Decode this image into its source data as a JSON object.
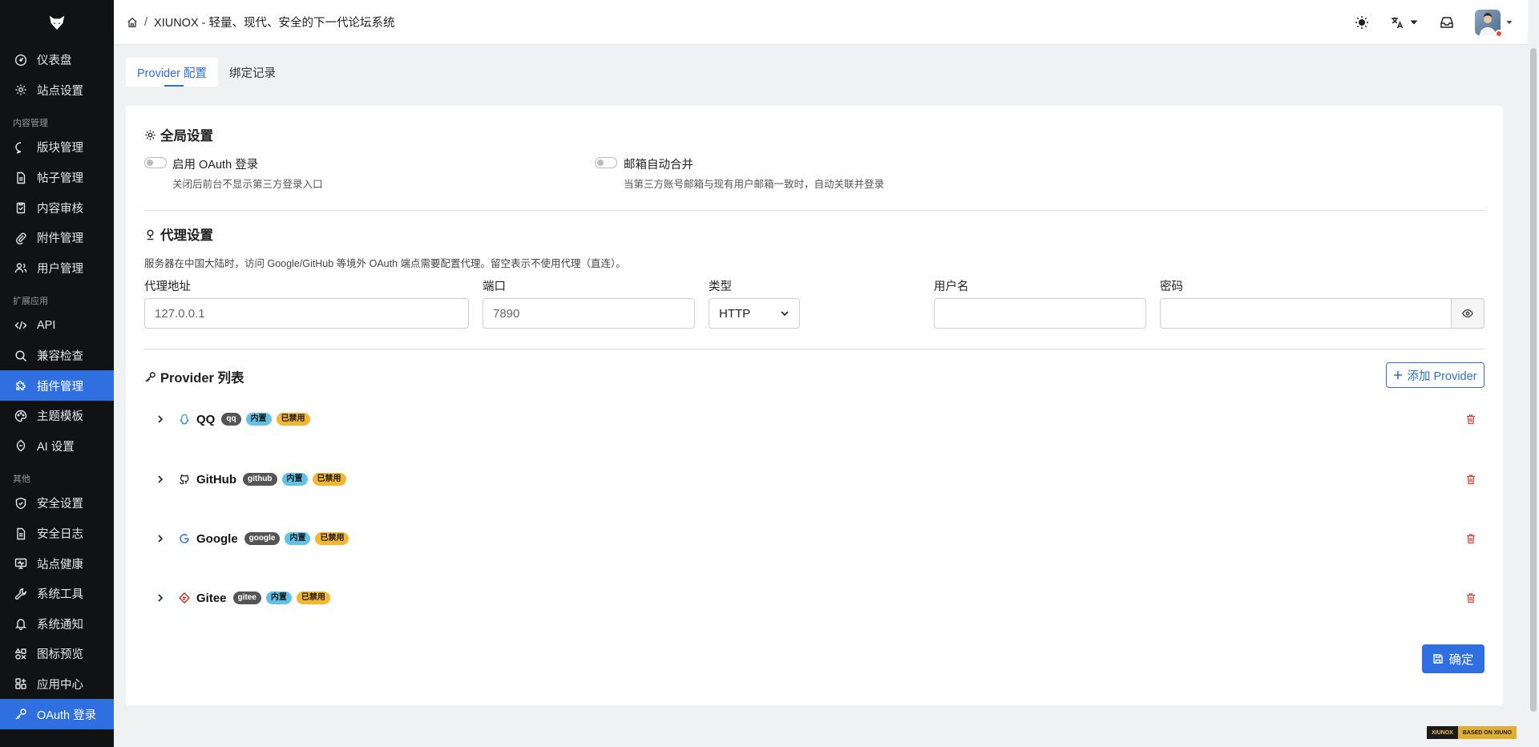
{
  "sidebar": {
    "top_items": [
      {
        "label": "仪表盘",
        "icon": "dashboard-icon"
      },
      {
        "label": "站点设置",
        "icon": "gear-icon"
      }
    ],
    "groups": [
      {
        "title": "内容管理",
        "items": [
          {
            "label": "版块管理",
            "icon": "chat-bubble-icon"
          },
          {
            "label": "帖子管理",
            "icon": "document-icon"
          },
          {
            "label": "内容审核",
            "icon": "clipboard-check-icon"
          },
          {
            "label": "附件管理",
            "icon": "paperclip-icon"
          },
          {
            "label": "用户管理",
            "icon": "users-icon"
          }
        ]
      },
      {
        "title": "扩展应用",
        "items": [
          {
            "label": "API",
            "icon": "code-icon"
          },
          {
            "label": "兼容检查",
            "icon": "search-icon"
          },
          {
            "label": "插件管理",
            "icon": "puzzle-icon",
            "active": true
          },
          {
            "label": "主题模板",
            "icon": "palette-icon"
          },
          {
            "label": "AI 设置",
            "icon": "robot-icon"
          }
        ]
      },
      {
        "title": "其他",
        "items": [
          {
            "label": "安全设置",
            "icon": "shield-icon"
          },
          {
            "label": "安全日志",
            "icon": "log-document-icon"
          },
          {
            "label": "站点健康",
            "icon": "monitor-icon"
          },
          {
            "label": "系统工具",
            "icon": "wrench-icon"
          },
          {
            "label": "系统通知",
            "icon": "bell-icon"
          },
          {
            "label": "图标预览",
            "icon": "icons-grid-icon"
          },
          {
            "label": "应用中心",
            "icon": "apps-icon"
          },
          {
            "label": "OAuth 登录",
            "icon": "key-icon",
            "active": true
          }
        ]
      }
    ]
  },
  "header": {
    "breadcrumb_sep": "/",
    "site_title": "XIUNOX - 轻量、现代、安全的下一代论坛系统"
  },
  "tabs": [
    {
      "label": "Provider 配置",
      "active": true
    },
    {
      "label": "绑定记录",
      "active": false
    }
  ],
  "global": {
    "title": "全局设置",
    "enable_oauth": {
      "label": "启用 OAuth 登录",
      "desc": "关闭后前台不显示第三方登录入口"
    },
    "auto_merge": {
      "label": "邮箱自动合并",
      "desc": "当第三方账号邮箱与现有用户邮箱一致时，自动关联并登录"
    }
  },
  "proxy": {
    "title": "代理设置",
    "hint": "服务器在中国大陆时，访问 Google/GitHub 等境外 OAuth 端点需要配置代理。留空表示不使用代理（直连）。",
    "address_label": "代理地址",
    "address_placeholder": "127.0.0.1",
    "port_label": "端口",
    "port_placeholder": "7890",
    "type_label": "类型",
    "type_value": "HTTP",
    "username_label": "用户名",
    "password_label": "密码"
  },
  "providers": {
    "title": "Provider 列表",
    "add_label": "添加 Provider",
    "items": [
      {
        "name": "QQ",
        "key": "qq",
        "builtin": "内置",
        "status": "已禁用",
        "icon": "qq-penguin-icon"
      },
      {
        "name": "GitHub",
        "key": "github",
        "builtin": "内置",
        "status": "已禁用",
        "icon": "github-icon"
      },
      {
        "name": "Google",
        "key": "google",
        "builtin": "内置",
        "status": "已禁用",
        "icon": "google-icon"
      },
      {
        "name": "Gitee",
        "key": "gitee",
        "builtin": "内置",
        "status": "已禁用",
        "icon": "gitee-icon"
      }
    ]
  },
  "confirm_label": "确定",
  "footer": {
    "left": "XIUNOX",
    "right": "BASED ON XIUNO"
  },
  "colors": {
    "accent": "#2f6fe0",
    "sidebar_bg": "#111214",
    "builtin_badge": "#62c2e6",
    "disabled_badge": "#f2b631",
    "danger": "#d9463b"
  }
}
